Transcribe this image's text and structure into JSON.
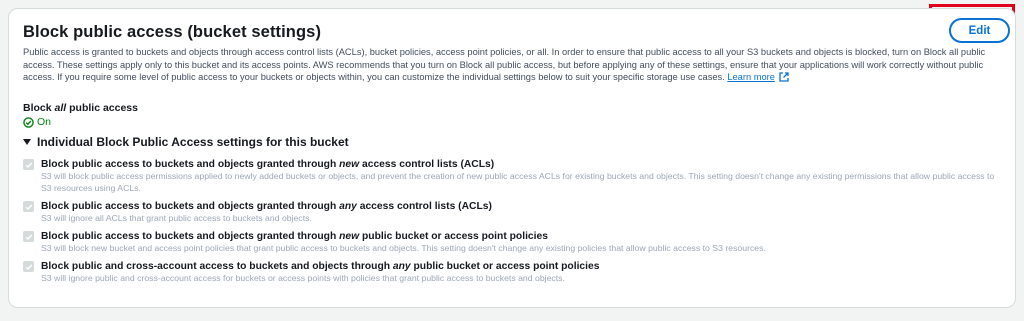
{
  "panel": {
    "title": "Block public access (bucket settings)",
    "edit_label": "Edit",
    "description": "Public access is granted to buckets and objects through access control lists (ACLs), bucket policies, access point policies, or all. In order to ensure that public access to all your S3 buckets and objects is blocked, turn on Block all public access. These settings apply only to this bucket and its access points. AWS recommends that you turn on Block all public access, but before applying any of these settings, ensure that your applications will work correctly without public access. If you require some level of public access to your buckets or objects within, you can customize the individual settings below to suit your specific storage use cases.",
    "learn_more": "Learn more",
    "block_all": {
      "prefix": "Block ",
      "emph": "all",
      "suffix": " public access",
      "status": "On"
    },
    "expander_label": "Individual Block Public Access settings for this bucket",
    "settings": [
      {
        "pre": "Block public access to buckets and objects granted through ",
        "emph": "new",
        "post": " access control lists (ACLs)",
        "sub": "S3 will block public access permissions applied to newly added buckets or objects, and prevent the creation of new public access ACLs for existing buckets and objects. This setting doesn't change any existing permissions that allow public access to S3 resources using ACLs."
      },
      {
        "pre": "Block public access to buckets and objects granted through ",
        "emph": "any",
        "post": " access control lists (ACLs)",
        "sub": "S3 will ignore all ACLs that grant public access to buckets and objects."
      },
      {
        "pre": "Block public access to buckets and objects granted through ",
        "emph": "new",
        "post": " public bucket or access point policies",
        "sub": "S3 will block new bucket and access point policies that grant public access to buckets and objects. This setting doesn't change any existing policies that allow public access to S3 resources."
      },
      {
        "pre": "Block public and cross-account access to buckets and objects through ",
        "emph": "any",
        "post": " public bucket or access point policies",
        "sub": "S3 will ignore public and cross-account access for buckets or access points with policies that grant public access to buckets and objects."
      }
    ]
  },
  "colors": {
    "accent": "#0972d3",
    "success": "#037f0c",
    "highlight": "#e0001b",
    "disabled": "#d5dbdb"
  }
}
